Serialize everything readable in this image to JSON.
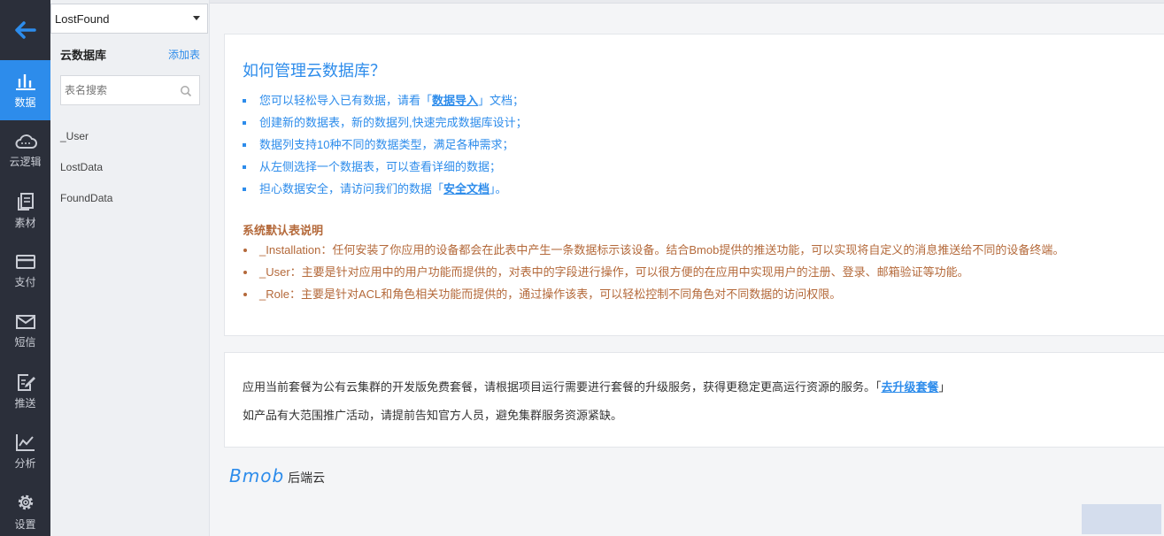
{
  "app_select": {
    "value": "LostFound"
  },
  "nav": [
    {
      "label": "数据",
      "icon": "bar-chart-icon",
      "active": true
    },
    {
      "label": "云逻辑",
      "icon": "cloud-icon"
    },
    {
      "label": "素材",
      "icon": "files-icon"
    },
    {
      "label": "支付",
      "icon": "card-icon"
    },
    {
      "label": "短信",
      "icon": "mail-icon"
    },
    {
      "label": "推送",
      "icon": "push-edit-icon"
    },
    {
      "label": "分析",
      "icon": "line-chart-icon"
    },
    {
      "label": "设置",
      "icon": "gear-icon"
    }
  ],
  "sidebar": {
    "title": "云数据库",
    "add_label": "添加表",
    "search_placeholder": "表名搜索",
    "tables": [
      "_User",
      "LostData",
      "FoundData"
    ]
  },
  "intro": {
    "heading": "如何管理云数据库？",
    "bullets": [
      {
        "pre": "您可以轻松导入已有数据，请看「",
        "link": "数据导入",
        "post": "」文档；"
      },
      {
        "pre": "创建新的数据表，新的数据列,快速完成数据库设计；"
      },
      {
        "pre": "数据列支持10种不同的数据类型，满足各种需求；"
      },
      {
        "pre": "从左侧选择一个数据表，可以查看详细的数据；"
      },
      {
        "pre": "担心数据安全，请访问我们的数据「",
        "link": "安全文档",
        "post": "」。"
      }
    ],
    "sys_title": "系统默认表说明",
    "sys_items": [
      "_Installation：任何安装了你应用的设备都会在此表中产生一条数据标示该设备。结合Bmob提供的推送功能，可以实现将自定义的消息推送给不同的设备终端。",
      "_User：主要是针对应用中的用户功能而提供的，对表中的字段进行操作，可以很方便的在应用中实现用户的注册、登录、邮箱验证等功能。",
      "_Role：主要是针对ACL和角色相关功能而提供的，通过操作该表，可以轻松控制不同角色对不同数据的访问权限。"
    ]
  },
  "plan": {
    "line1_pre": "应用当前套餐为公有云集群的开发版免费套餐，请根据项目运行需要进行套餐的升级服务，获得更稳定更高运行资源的服务。「",
    "line1_link": "去升级套餐",
    "line1_post": "」",
    "line2": "如产品有大范围推广活动，请提前告知官方人员，避免集群服务资源紧缺。"
  },
  "footer": {
    "logo": "Bmob",
    "suffix": "后端云"
  },
  "colors": {
    "accent": "#2d8ceb",
    "sidebar_dark": "#2b2f3a",
    "note": "#b4693a"
  }
}
